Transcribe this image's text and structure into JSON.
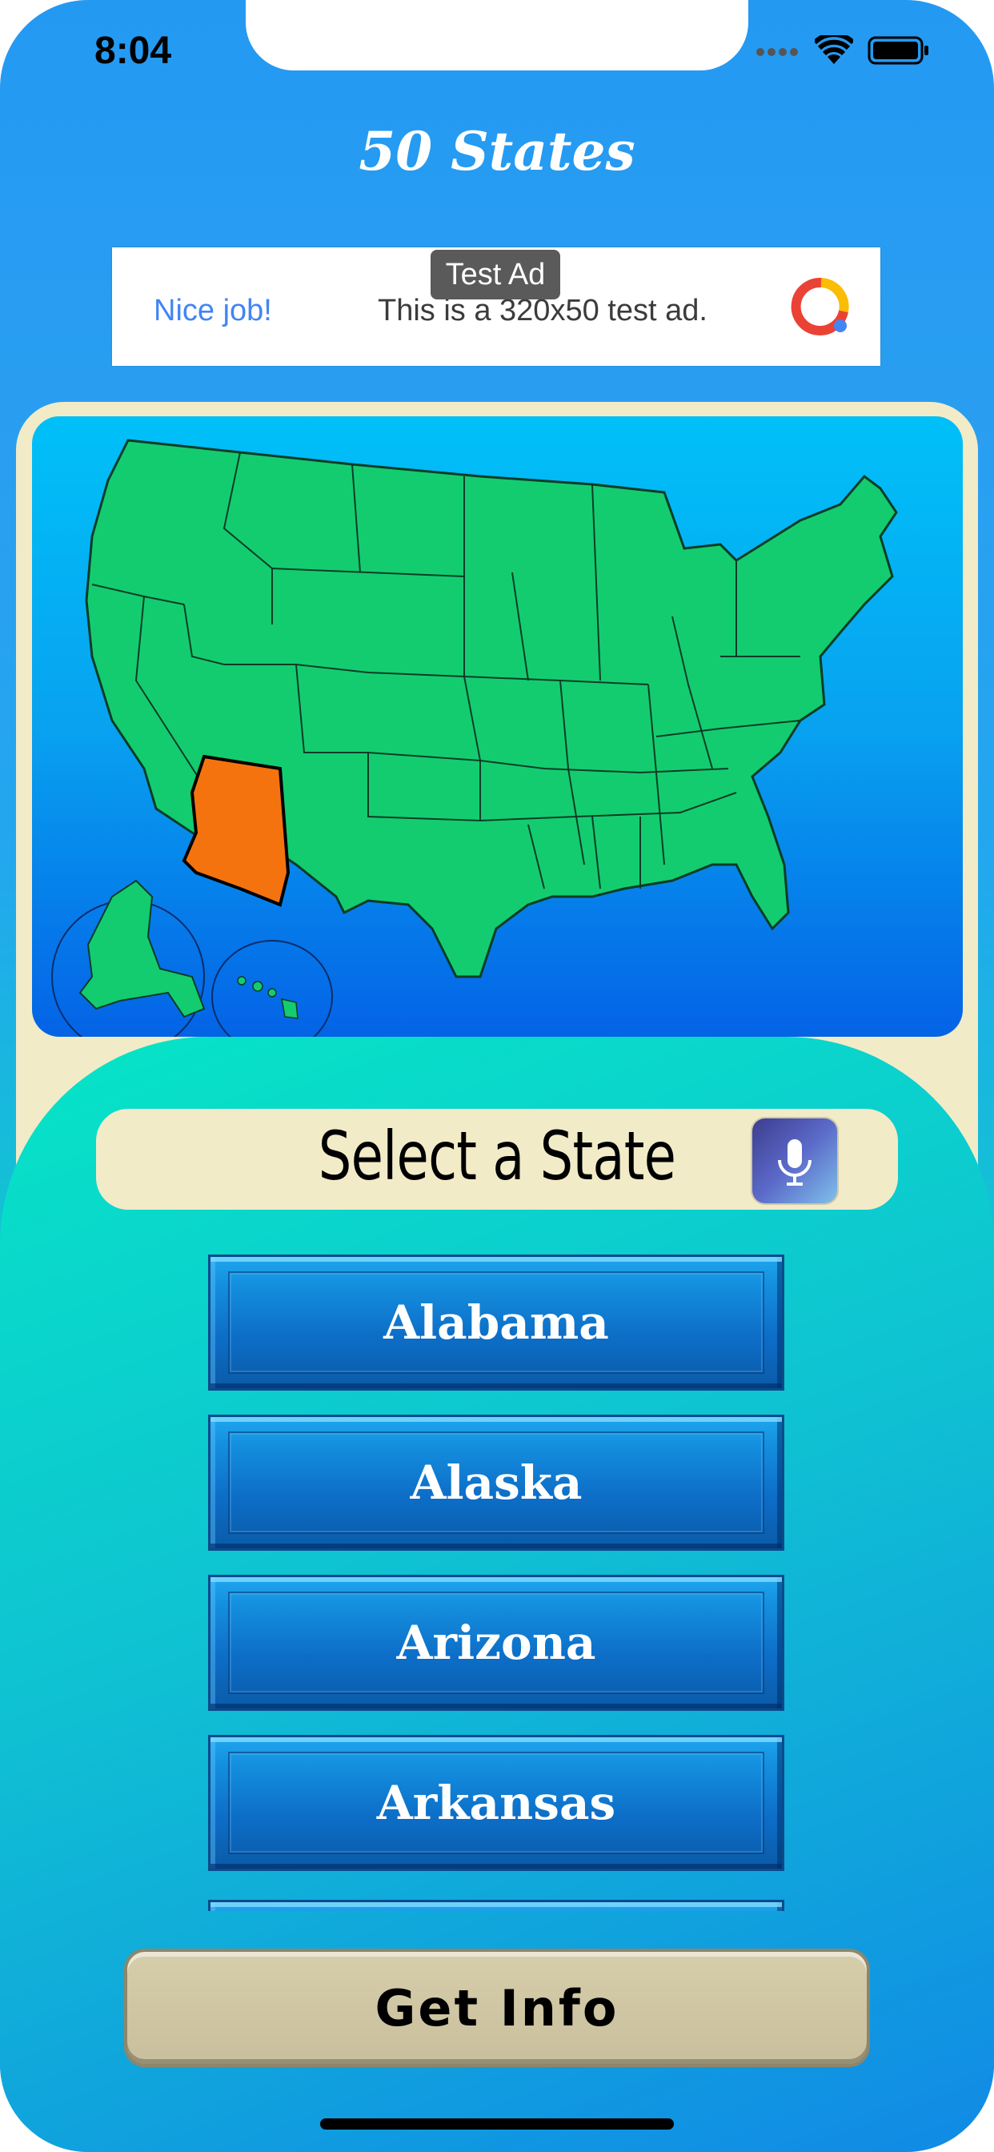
{
  "status_bar": {
    "time": "8:04"
  },
  "app": {
    "title": "50 States"
  },
  "ad": {
    "badge": "Test Ad",
    "headline": "Nice job!",
    "body": "This is a 320x50 test ad."
  },
  "map": {
    "highlighted_state": "Arizona",
    "highlight_color": "#f5730f",
    "state_color": "#14cc70"
  },
  "select": {
    "label": "Select a State",
    "mic_icon": "microphone-icon"
  },
  "states": [
    {
      "label": "Alabama"
    },
    {
      "label": "Alaska"
    },
    {
      "label": "Arizona"
    },
    {
      "label": "Arkansas"
    }
  ],
  "actions": {
    "get_info": "Get  Info"
  }
}
